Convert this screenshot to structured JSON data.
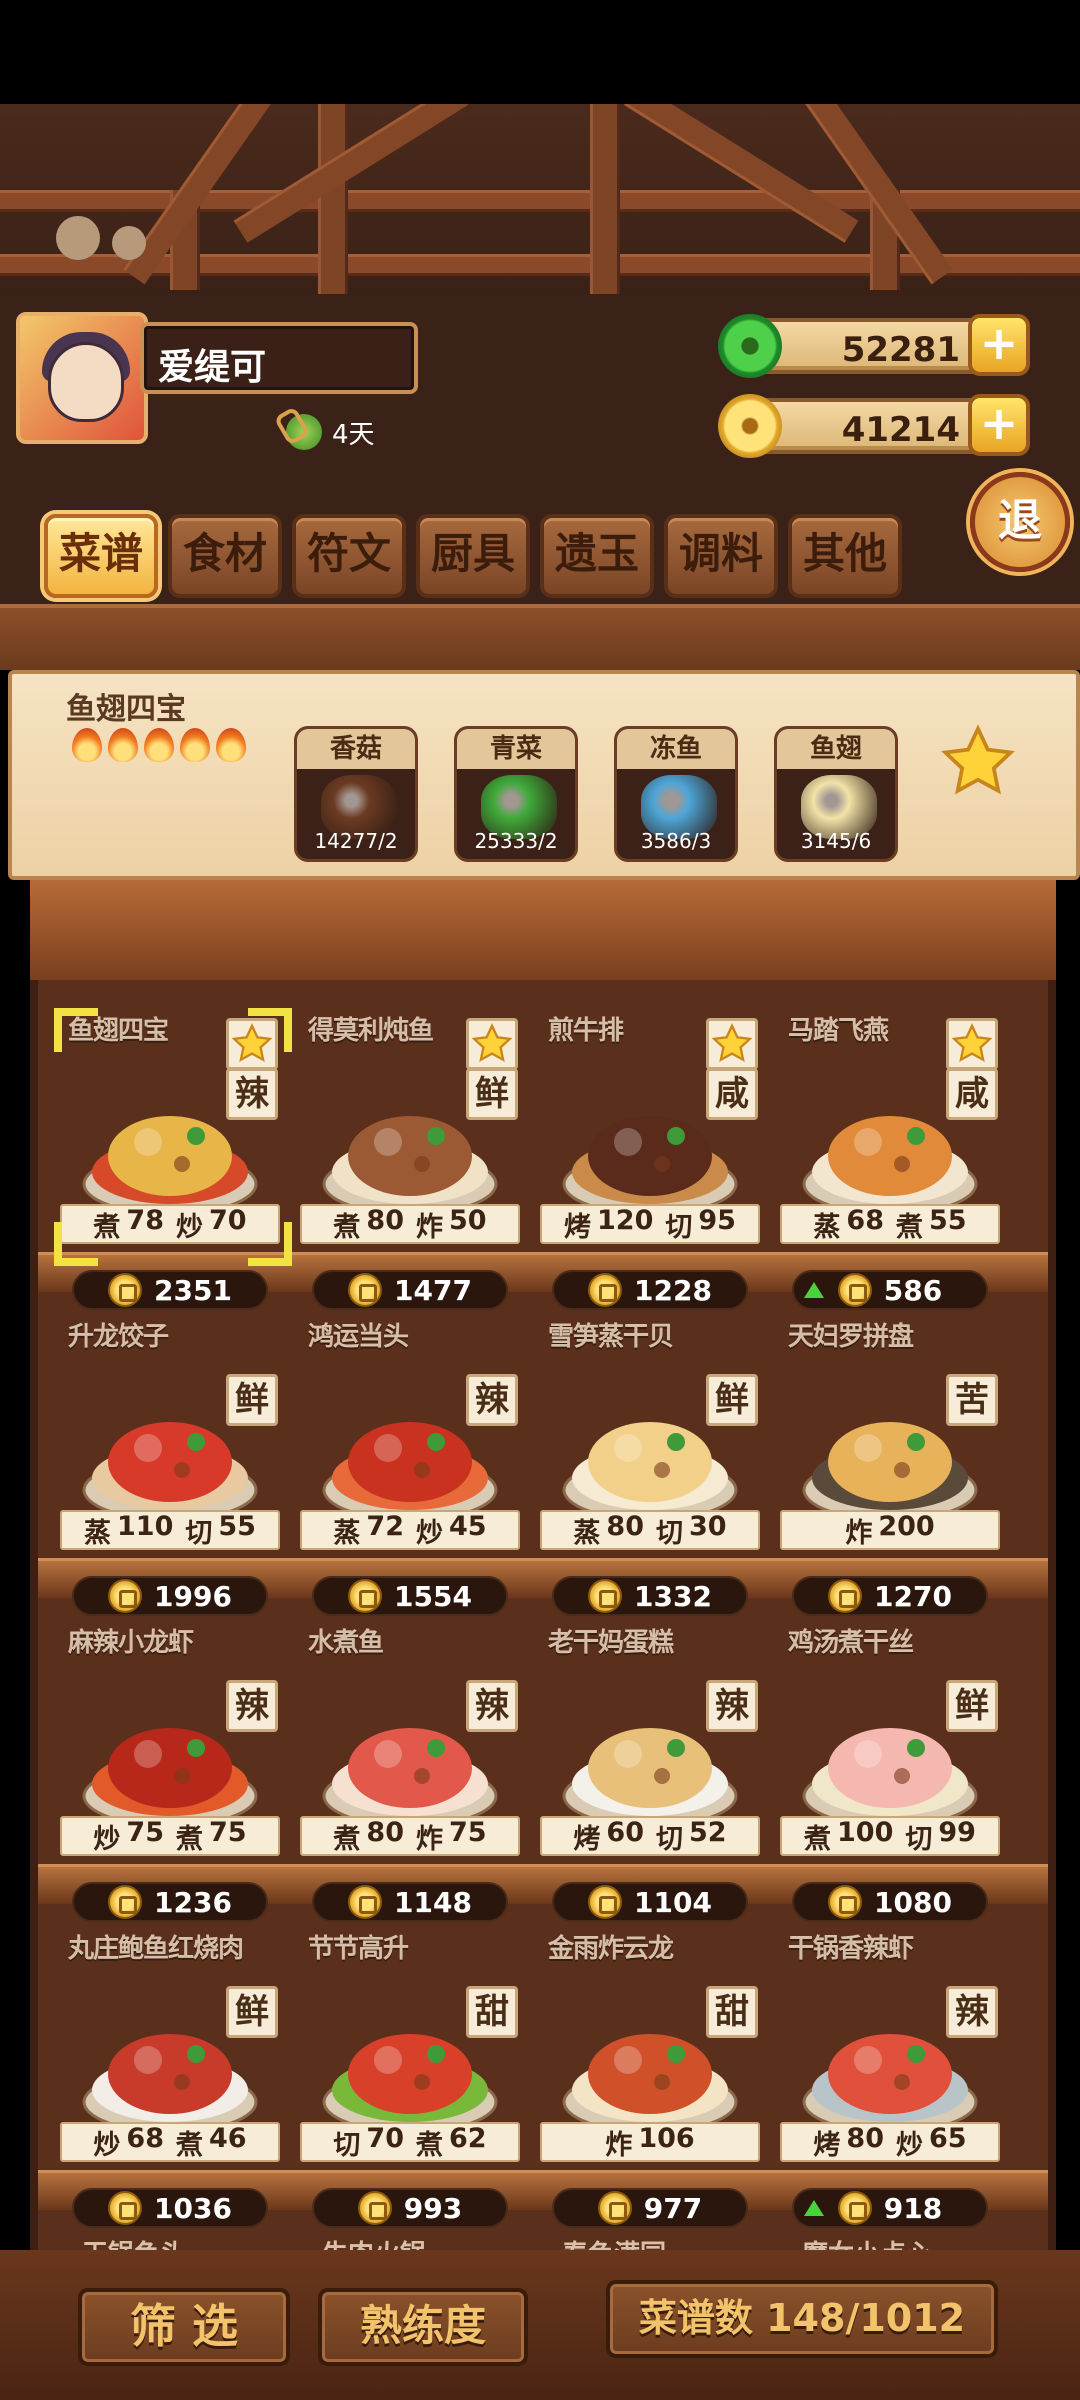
{
  "player": {
    "name": "爱缇可",
    "days": "4天"
  },
  "currency": {
    "jade": "52281",
    "coins": "41214",
    "plus": "+"
  },
  "exit_label": "退",
  "tabs": [
    "菜谱",
    "食材",
    "符文",
    "厨具",
    "遗玉",
    "调料",
    "其他"
  ],
  "detail": {
    "dish_name": "鱼翅四宝",
    "flames": 5,
    "ingredients": [
      {
        "name": "香菇",
        "qty": "14277/2",
        "color": "#6b3b22"
      },
      {
        "name": "青菜",
        "qty": "25333/2",
        "color": "#3faa3a"
      },
      {
        "name": "冻鱼",
        "qty": "3586/3",
        "color": "#4da6d8"
      },
      {
        "name": "鱼翅",
        "qty": "3145/6",
        "color": "#f3e3a8"
      }
    ]
  },
  "recipes": [
    {
      "name": "鱼翅四宝",
      "flavor": "辣",
      "fav": true,
      "s1": "煮",
      "v1": "78",
      "s2": "炒",
      "v2": "70",
      "price": "2351",
      "up": false,
      "selected": true,
      "c1": "#e7b548",
      "c2": "#d64a2a"
    },
    {
      "name": "得莫利炖鱼",
      "flavor": "鲜",
      "fav": true,
      "s1": "煮",
      "v1": "80",
      "s2": "炸",
      "v2": "50",
      "price": "1477",
      "up": false,
      "selected": false,
      "c1": "#9c5a34",
      "c2": "#f0e2c6"
    },
    {
      "name": "煎牛排",
      "flavor": "咸",
      "fav": true,
      "s1": "烤",
      "v1": "120",
      "s2": "切",
      "v2": "95",
      "price": "1228",
      "up": false,
      "selected": false,
      "c1": "#5a2a1a",
      "c2": "#c98a4a"
    },
    {
      "name": "马踏飞燕",
      "flavor": "咸",
      "fav": true,
      "s1": "蒸",
      "v1": "68",
      "s2": "煮",
      "v2": "55",
      "price": "586",
      "up": true,
      "selected": false,
      "c1": "#e08a3a",
      "c2": "#f2e6d0"
    },
    {
      "name": "升龙饺子",
      "flavor": "鲜",
      "fav": false,
      "s1": "蒸",
      "v1": "110",
      "s2": "切",
      "v2": "55",
      "price": "1996",
      "up": false,
      "selected": false,
      "c1": "#d83a2a",
      "c2": "#e8c9a0"
    },
    {
      "name": "鸿运当头",
      "flavor": "辣",
      "fav": false,
      "s1": "蒸",
      "v1": "72",
      "s2": "炒",
      "v2": "45",
      "price": "1554",
      "up": false,
      "selected": false,
      "c1": "#c8321e",
      "c2": "#e86a3a"
    },
    {
      "name": "雪笋蒸干贝",
      "flavor": "鲜",
      "fav": false,
      "s1": "蒸",
      "v1": "80",
      "s2": "切",
      "v2": "30",
      "price": "1332",
      "up": false,
      "selected": false,
      "c1": "#f2d08a",
      "c2": "#f6ead2"
    },
    {
      "name": "天妇罗拼盘",
      "flavor": "苦",
      "fav": false,
      "s1": "炸",
      "v1": "200",
      "s2": "",
      "v2": "",
      "price": "1270",
      "up": false,
      "selected": false,
      "c1": "#e8b25a",
      "c2": "#5a4a3a"
    },
    {
      "name": "麻辣小龙虾",
      "flavor": "辣",
      "fav": false,
      "s1": "炒",
      "v1": "75",
      "s2": "煮",
      "v2": "75",
      "price": "1236",
      "up": false,
      "selected": false,
      "c1": "#b8281a",
      "c2": "#e25a2a"
    },
    {
      "name": "水煮鱼",
      "flavor": "辣",
      "fav": false,
      "s1": "煮",
      "v1": "80",
      "s2": "炸",
      "v2": "75",
      "price": "1148",
      "up": false,
      "selected": false,
      "c1": "#e2584a",
      "c2": "#f6e0d0"
    },
    {
      "name": "老干妈蛋糕",
      "flavor": "辣",
      "fav": false,
      "s1": "烤",
      "v1": "60",
      "s2": "切",
      "v2": "52",
      "price": "1104",
      "up": false,
      "selected": false,
      "c1": "#e8c07a",
      "c2": "#f4f0ea"
    },
    {
      "name": "鸡汤煮干丝",
      "flavor": "鲜",
      "fav": false,
      "s1": "煮",
      "v1": "100",
      "s2": "切",
      "v2": "99",
      "price": "1080",
      "up": false,
      "selected": false,
      "c1": "#f4b8b0",
      "c2": "#f0e6c8"
    },
    {
      "name": "丸庄鲍鱼红烧肉",
      "flavor": "鲜",
      "fav": false,
      "s1": "炒",
      "v1": "68",
      "s2": "煮",
      "v2": "46",
      "price": "1036",
      "up": false,
      "selected": false,
      "c1": "#c83a2a",
      "c2": "#f2ede6"
    },
    {
      "name": "节节高升",
      "flavor": "甜",
      "fav": false,
      "s1": "切",
      "v1": "70",
      "s2": "煮",
      "v2": "62",
      "price": "993",
      "up": false,
      "selected": false,
      "c1": "#d8402a",
      "c2": "#7ab83a"
    },
    {
      "name": "金雨炸云龙",
      "flavor": "甜",
      "fav": false,
      "s1": "炸",
      "v1": "106",
      "s2": "",
      "v2": "",
      "price": "977",
      "up": false,
      "selected": false,
      "c1": "#d0502a",
      "c2": "#f2e4c4"
    },
    {
      "name": "干锅香辣虾",
      "flavor": "辣",
      "fav": false,
      "s1": "烤",
      "v1": "80",
      "s2": "炒",
      "v2": "65",
      "price": "918",
      "up": true,
      "selected": false,
      "c1": "#e0503a",
      "c2": "#b8c4c8"
    }
  ],
  "next_row_names": [
    "干锅鱼头",
    "牛肉火锅",
    "春色满园",
    "魔女小点心"
  ],
  "bottom": {
    "filter": "筛 选",
    "proficiency": "熟练度",
    "count": "菜谱数 148/1012"
  },
  "colors": {
    "accent": "#f3b43f",
    "wood": "#5a2f1b"
  }
}
